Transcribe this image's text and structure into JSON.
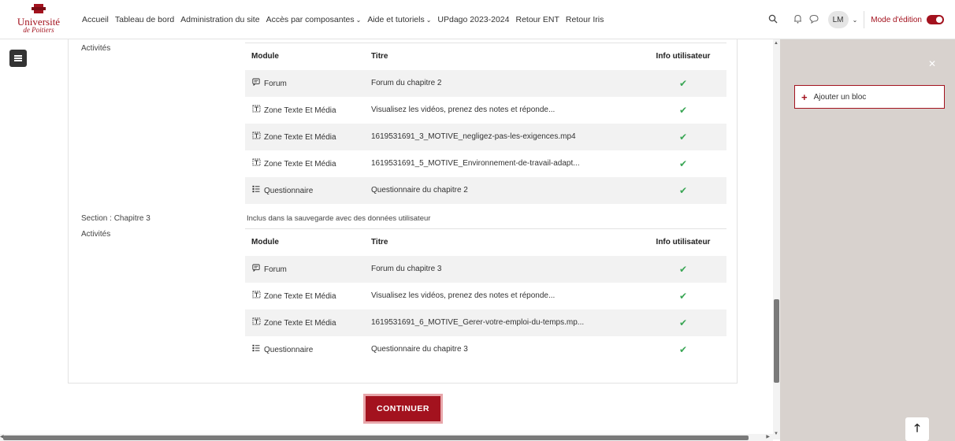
{
  "brand": {
    "line1": "Université",
    "line2": "de Poitiers"
  },
  "nav": {
    "links": [
      {
        "label": "Accueil",
        "dropdown": false
      },
      {
        "label": "Tableau de bord",
        "dropdown": false
      },
      {
        "label": "Administration du site",
        "dropdown": false
      },
      {
        "label": "Accès par composantes",
        "dropdown": true
      },
      {
        "label": "Aide et tutoriels",
        "dropdown": true
      },
      {
        "label": "UPdago 2023-2024",
        "dropdown": false
      },
      {
        "label": "Retour ENT",
        "dropdown": false
      },
      {
        "label": "Retour Iris",
        "dropdown": false
      }
    ],
    "user_initials": "LM",
    "edit_mode_label": "Mode d'édition",
    "edit_mode_on": true
  },
  "sections": [
    {
      "section_label": "",
      "section_note": "",
      "activities_label": "Activités",
      "headers": {
        "module": "Module",
        "title": "Titre",
        "user_info": "Info utilisateur"
      },
      "rows": [
        {
          "module": "Forum",
          "icon": "forum-icon",
          "title": "Forum du chapitre 2",
          "check": "✔"
        },
        {
          "module": "Zone Texte Et Média",
          "icon": "media-zone-icon",
          "title": "Visualisez les vidéos, prenez des notes et réponde...",
          "check": "✔"
        },
        {
          "module": "Zone Texte Et Média",
          "icon": "media-zone-icon",
          "title": "1619531691_3_MOTIVE_negligez-pas-les-exigences.mp4",
          "check": "✔"
        },
        {
          "module": "Zone Texte Et Média",
          "icon": "media-zone-icon",
          "title": "1619531691_5_MOTIVE_Environnement-de-travail-adapt...",
          "check": "✔"
        },
        {
          "module": "Questionnaire",
          "icon": "questionnaire-icon",
          "title": "Questionnaire du chapitre 2",
          "check": "✔"
        }
      ]
    },
    {
      "section_label": "Section : Chapitre 3",
      "section_note": "Inclus dans la sauvegarde avec des données utilisateur",
      "activities_label": "Activités",
      "headers": {
        "module": "Module",
        "title": "Titre",
        "user_info": "Info utilisateur"
      },
      "rows": [
        {
          "module": "Forum",
          "icon": "forum-icon",
          "title": "Forum du chapitre 3",
          "check": "✔"
        },
        {
          "module": "Zone Texte Et Média",
          "icon": "media-zone-icon",
          "title": "Visualisez les vidéos, prenez des notes et réponde...",
          "check": "✔"
        },
        {
          "module": "Zone Texte Et Média",
          "icon": "media-zone-icon",
          "title": "1619531691_6_MOTIVE_Gerer-votre-emploi-du-temps.mp...",
          "check": "✔"
        },
        {
          "module": "Questionnaire",
          "icon": "questionnaire-icon",
          "title": "Questionnaire du chapitre 3",
          "check": "✔"
        }
      ]
    }
  ],
  "continue_label": "CONTINUER",
  "right_drawer": {
    "add_block_label": "Ajouter un bloc"
  },
  "colors": {
    "brand": "#a3121e",
    "check": "#3aa655",
    "drawer_bg": "#d8d2ce"
  }
}
